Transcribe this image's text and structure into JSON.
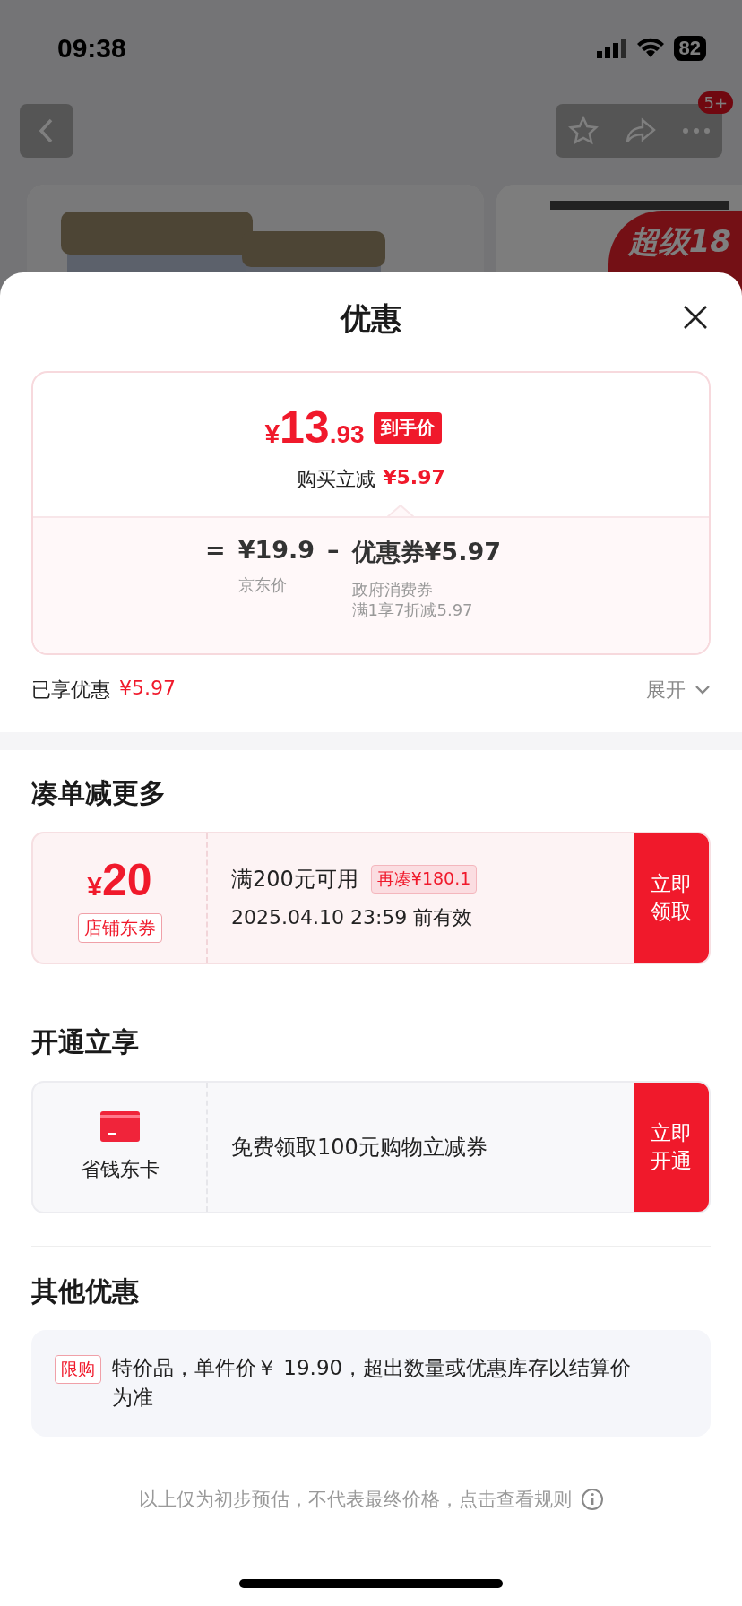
{
  "status_bar": {
    "time": "09:38",
    "battery": "82"
  },
  "backdrop": {
    "badge": "5+",
    "promo": "超级18"
  },
  "sheet": {
    "title": "优惠"
  },
  "price_card": {
    "currency": "¥",
    "integer": "13",
    "decimal": ".93",
    "tag": "到手价",
    "saving_label": "购买立减",
    "saving": "¥5.97",
    "equals": "=",
    "base_price": "¥19.9",
    "base_caption": "京东价",
    "minus": "–",
    "coupon_price": "优惠券¥5.97",
    "coupon_captions": [
      "政府消费券",
      "满1享7折减5.97"
    ]
  },
  "summary": {
    "label": "已享优惠",
    "amount": "¥5.97",
    "toggle": "展开",
    "expanded": false
  },
  "sections": [
    {
      "kind": "coupon",
      "title": "凑单减更多",
      "currency": "¥",
      "amount": "20",
      "tag": "店铺东券",
      "condition": "满200元可用",
      "hint": "再凑¥180.1",
      "validity": "2025.04.10 23:59 前有效",
      "button": "立即领取"
    },
    {
      "kind": "membership",
      "title": "开通立享",
      "name": "省钱东卡",
      "offer": "免费领取100元购物立减券",
      "button": "立即开通"
    },
    {
      "kind": "notice",
      "title": "其他优惠",
      "tag": "限购",
      "text": "特价品，单件价￥ 19.90，超出数量或优惠库存以结算价为准"
    }
  ],
  "footer": {
    "text": "以上仅为初步预估，不代表最终价格，点击查看规则"
  }
}
